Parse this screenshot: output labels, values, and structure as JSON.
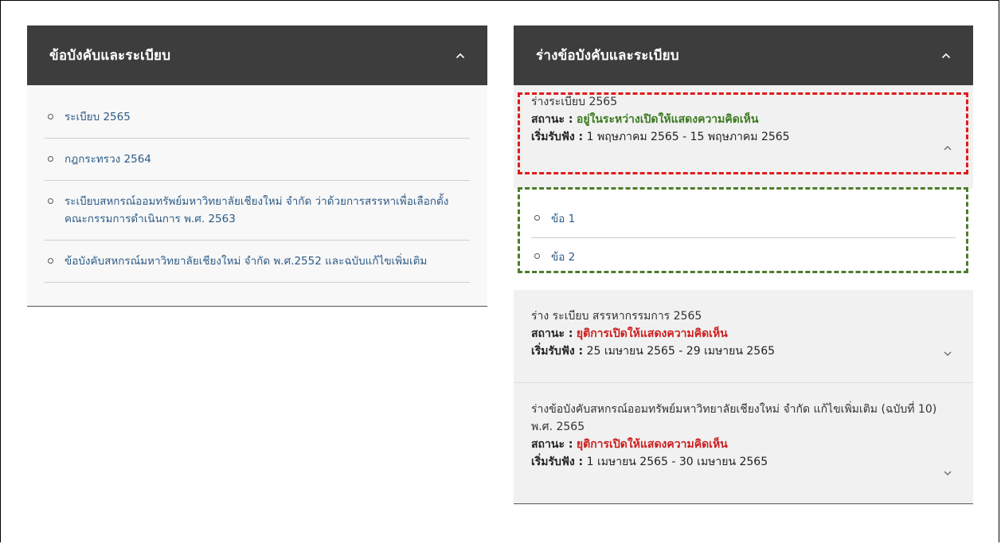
{
  "left": {
    "title": "ข้อบังคับและระเบียบ",
    "items": [
      {
        "label": "ระเบียบ 2565"
      },
      {
        "label": "กฎกระทรวง 2564"
      },
      {
        "label": "ระเบียบสหกรณ์ออมทรัพย์มหาวิทยาลัยเชียงใหม่ จำกัด ว่าด้วยการสรรหาเพื่อเลือกตั้งคณะกรรมการดำเนินการ พ.ศ. 2563"
      },
      {
        "label": "ข้อบังคับสหกรณ์มหาวิทยาลัยเชียงใหม่ จำกัด พ.ศ.2552 และฉบับแก้ไขเพิ่มเติม"
      }
    ]
  },
  "right": {
    "title": "ร่างข้อบังคับและระเบียบ",
    "status_label": "สถานะ :",
    "start_label": "เริ่มรับฟัง :",
    "drafts": [
      {
        "title": "ร่างระเบียบ 2565",
        "status": "อยู่ในระหว่างเปิดให้แสดงความคิดเห็น",
        "dates": "1 พฤษภาคม 2565 - 15 พฤษภาคม 2565",
        "expanded": true,
        "subitems": [
          "ข้อ 1",
          "ข้อ 2"
        ]
      },
      {
        "title": "ร่าง ระเบียบ สรรหากรรมการ 2565",
        "status": "ยุติการเปิดให้แสดงความคิดเห็น",
        "dates": "25 เมษายน 2565 - 29 เมษายน 2565",
        "expanded": false
      },
      {
        "title": "ร่างข้อบังคับสหกรณ์ออมทรัพย์มหาวิทยาลัยเชียงใหม่ จำกัด แก้ไขเพิ่มเติม (ฉบับที่ 10) พ.ศ. 2565",
        "status": "ยุติการเปิดให้แสดงความคิดเห็น",
        "dates": "1 เมษายน 2565 - 30 เมษายน 2565",
        "expanded": false
      }
    ]
  },
  "colors": {
    "header_bg": "#3d3d3d",
    "link": "#2e5b86",
    "status_open": "#3a7a1e",
    "status_closed": "#cc1e1e",
    "highlight_red": "#e01b1b",
    "highlight_green": "#4c7d2a"
  },
  "icons": {
    "collapse": "chevron-up-icon",
    "expand": "chevron-down-icon",
    "bullet": "circle-bullet-icon"
  }
}
